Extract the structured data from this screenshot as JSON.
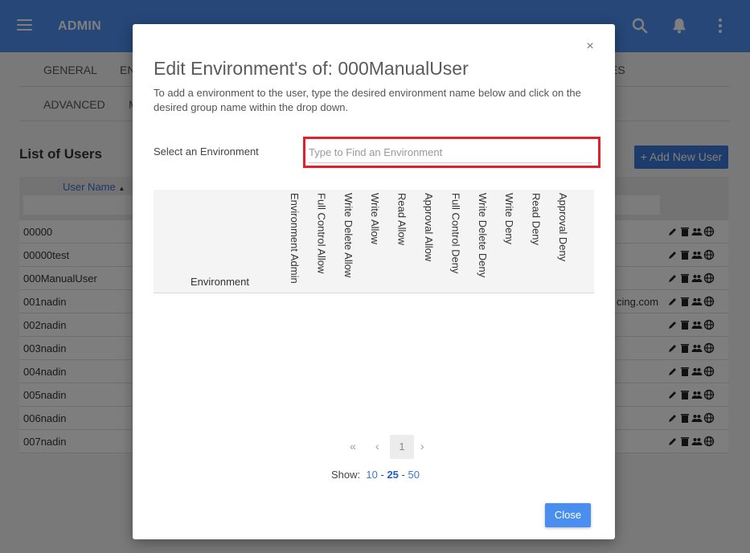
{
  "header": {
    "title": "ADMIN"
  },
  "tabs": {
    "row1": [
      "GENERAL",
      "EN",
      "ES"
    ],
    "row2": [
      "ADVANCED",
      "M"
    ]
  },
  "users_list": {
    "title": "List of Users",
    "add_button": "+ Add New User",
    "column_user_name": "User Name",
    "sort_indicator": "▲",
    "rows": [
      {
        "name": "00000",
        "email": ""
      },
      {
        "name": "00000test",
        "email": ""
      },
      {
        "name": "000ManualUser",
        "email": ""
      },
      {
        "name": "001nadin",
        "email": "cing.com"
      },
      {
        "name": "002nadin",
        "email": ""
      },
      {
        "name": "003nadin",
        "email": ""
      },
      {
        "name": "004nadin",
        "email": ""
      },
      {
        "name": "005nadin",
        "email": ""
      },
      {
        "name": "006nadin",
        "email": ""
      },
      {
        "name": "007nadin",
        "email": ""
      }
    ]
  },
  "modal": {
    "close_symbol": "×",
    "title": "Edit Environment's of: 000ManualUser",
    "description": "To add a environment to the user, type the desired environment name below and click on the desired group name within the drop down.",
    "select_label": "Select an Environment",
    "input_placeholder": "Type to Find an Environment",
    "input_value": "",
    "table": {
      "col_environment": "Environment",
      "permission_columns": [
        "Environment Admin",
        "Full Control Allow",
        "Write Delete Allow",
        "Write Allow",
        "Read Allow",
        "Approval Allow",
        "Full Control Deny",
        "Write Delete Deny",
        "Write Deny",
        "Read Deny",
        "Approval Deny"
      ]
    },
    "pager": {
      "first": "«",
      "prev": "‹",
      "current_page": "1",
      "next": "›"
    },
    "show": {
      "label": "Show:",
      "options": [
        "10",
        "25",
        "50"
      ],
      "selected": "25",
      "separator": "-"
    },
    "close_button": "Close"
  },
  "colors": {
    "topbar": "#4c8ff0",
    "accent": "#3d78d6",
    "highlight_border": "#e0202a"
  }
}
